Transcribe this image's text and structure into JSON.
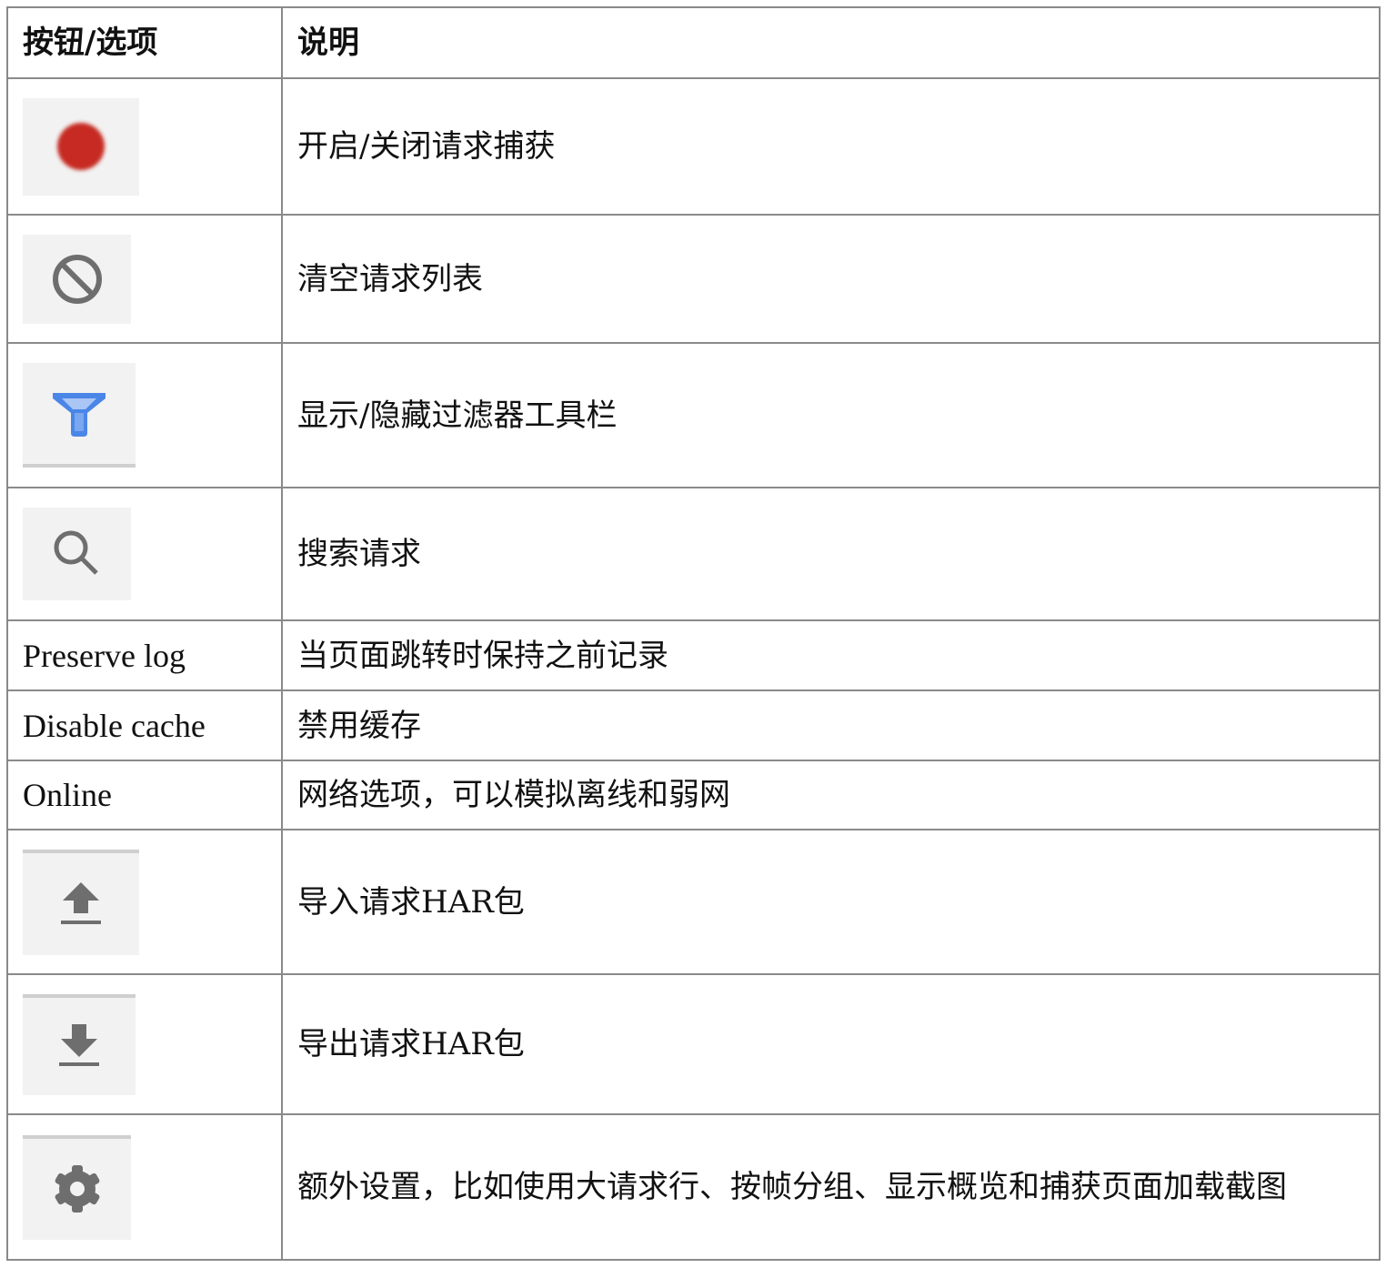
{
  "header": {
    "col1": "按钮/选项",
    "col2": "说明"
  },
  "rows": [
    {
      "icon": "record-icon",
      "desc": "开启/关闭请求捕获"
    },
    {
      "icon": "clear-icon",
      "desc": "清空请求列表"
    },
    {
      "icon": "filter-icon",
      "desc": "显示/隐藏过滤器工具栏"
    },
    {
      "icon": "search-icon",
      "desc": "搜索请求"
    },
    {
      "label": "Preserve log",
      "desc": "当页面跳转时保持之前记录"
    },
    {
      "label": "Disable cache",
      "desc": "禁用缓存"
    },
    {
      "label": "Online",
      "desc": "网络选项，可以模拟离线和弱网"
    },
    {
      "icon": "import-icon",
      "desc": "导入请求HAR包"
    },
    {
      "icon": "export-icon",
      "desc": "导出请求HAR包"
    },
    {
      "icon": "gear-icon",
      "desc": "额外设置，比如使用大请求行、按帧分组、显示概览和捕获页面加载截图"
    }
  ],
  "colors": {
    "record": "#c62b22",
    "filter": "#4a86e8",
    "icon_gray": "#6e6e6e",
    "icon_bg": "#f2f2f2",
    "border": "#8a8a8a"
  }
}
